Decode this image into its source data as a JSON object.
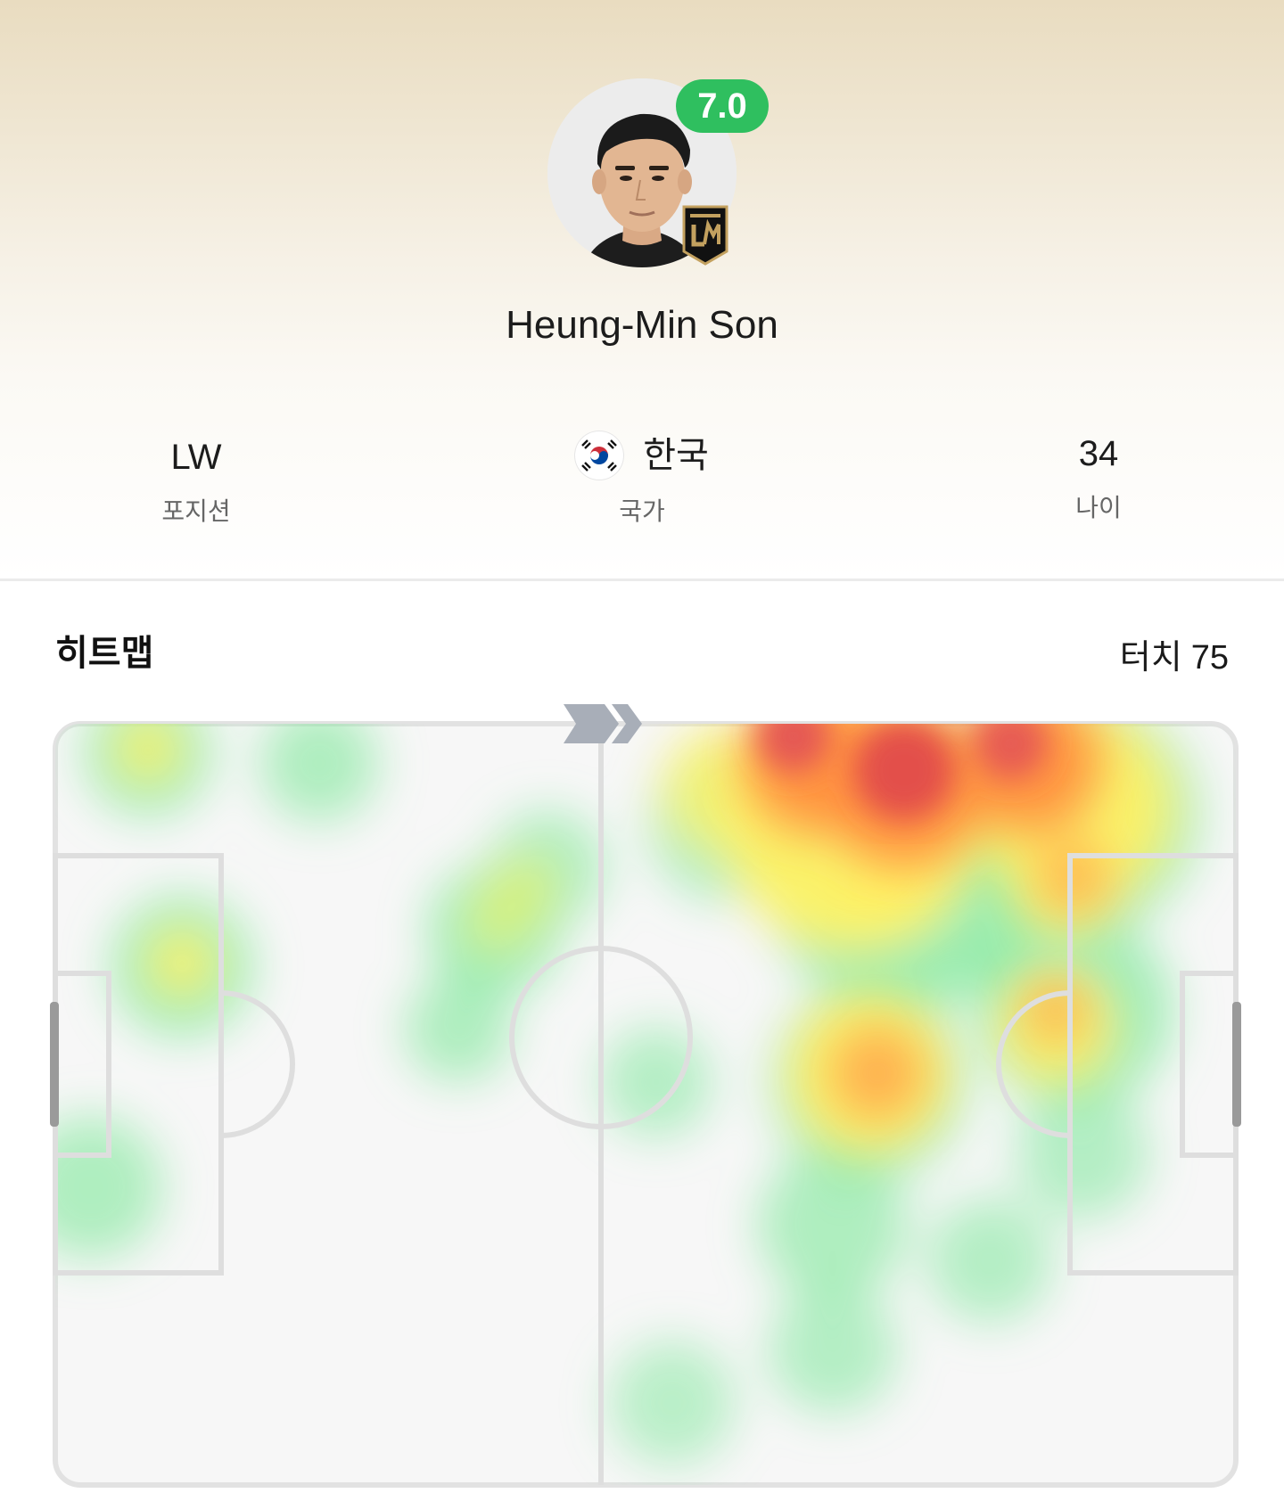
{
  "player": {
    "name": "Heung-Min Son",
    "rating": "7.0",
    "rating_color": "#2fbf5f",
    "club_crest_icon": "lafc-crest-icon",
    "avatar_icon": "player-photo"
  },
  "stats": {
    "position": {
      "value": "LW",
      "label": "포지션"
    },
    "country": {
      "value": "한국",
      "label": "국가",
      "flag_icon": "south-korea-flag-icon"
    },
    "age": {
      "value": "34",
      "label": "나이"
    }
  },
  "heatmap": {
    "title": "히트맵",
    "touches_label": "터치",
    "touches_value": "75",
    "direction_icon": "attack-direction-chevron-icon"
  }
}
